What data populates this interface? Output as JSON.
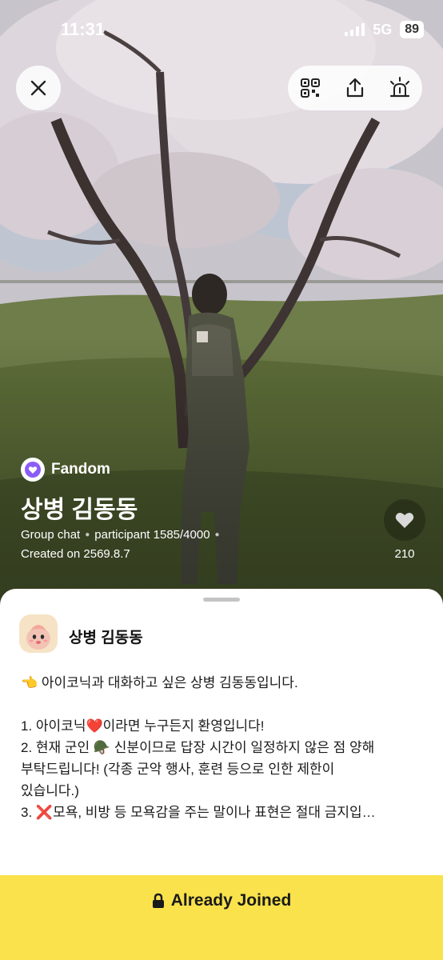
{
  "status_bar": {
    "time": "11:31",
    "network": "5G",
    "battery": "89"
  },
  "top_controls": {
    "close_icon": "close-icon",
    "actions": [
      "qr-code-icon",
      "share-icon",
      "report-siren-icon"
    ]
  },
  "room": {
    "category": "Fandom",
    "title": "상병 김동동",
    "meta": {
      "type": "Group chat",
      "participants": "participant 1585/4000",
      "created": "Created on 2569.8.7"
    },
    "likes": "210"
  },
  "sheet": {
    "host_name": "상병 김동동",
    "description": [
      "👈 아이코닉과 대화하고 싶은 상병 김동동입니다.",
      "",
      "1. 아이코닉❤️이라면 누구든지 환영입니다!",
      "2. 현재 군인 🪖 신분이므로 답장 시간이 일정하지 않은 점 양해",
      "부탁드립니다! (각종 군악 행사, 훈련 등으로 인한 제한이",
      "있습니다.)",
      "3. ❌모욕, 비방 등 모욕감을 주는 말이나 표현은 절대 금지입…"
    ]
  },
  "join": {
    "label": "Already Joined",
    "icon": "lock-icon"
  },
  "colors": {
    "join_bar": "#f9e24b",
    "fandom_badge": "#8b5cf6",
    "sheet_bg": "#ffffff"
  }
}
